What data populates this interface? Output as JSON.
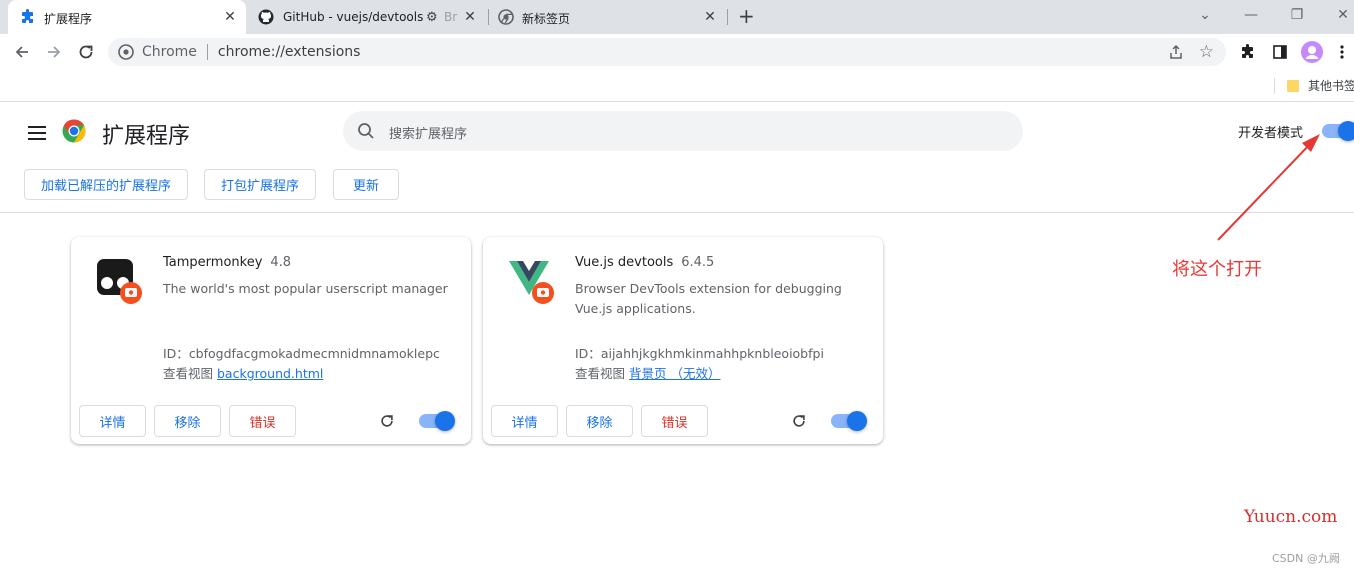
{
  "browser": {
    "tabs": [
      {
        "title": "扩展程序",
        "icon": "puzzle-icon",
        "active": true
      },
      {
        "title": "GitHub - vuejs/devtools:",
        "suffix": "Br",
        "icon": "github-icon",
        "active": false
      },
      {
        "title": "新标签页",
        "icon": "chrome-icon",
        "active": false
      }
    ],
    "new_tab_label": "+",
    "omnibox": {
      "site_label": "Chrome",
      "url": "chrome://extensions"
    },
    "bookmarks": {
      "other_label": "其他书签"
    },
    "accent": "#1a73e8"
  },
  "page": {
    "title": "扩展程序",
    "search_placeholder": "搜索扩展程序",
    "dev_mode_label": "开发者模式",
    "dev_mode_on": true,
    "actions": {
      "load_unpacked": "加载已解压的扩展程序",
      "pack": "打包扩展程序",
      "update": "更新"
    }
  },
  "extensions": [
    {
      "name": "Tampermonkey",
      "version": "4.8",
      "description": "The world's most popular userscript manager",
      "id_label": "ID：",
      "id": "cbfogdfacgmokadmecmnidmnamoklepc",
      "views_label": "查看视图",
      "view_link": "background.html",
      "details": "详情",
      "remove": "移除",
      "errors": "错误",
      "enabled": true
    },
    {
      "name": "Vue.js devtools",
      "version": "6.4.5",
      "description": "Browser DevTools extension for debugging Vue.js applications.",
      "id_label": "ID：",
      "id": "aijahhjkgkhmkinmahhpknbleoiobfpi",
      "views_label": "查看视图",
      "view_link": "背景页 （无效）",
      "details": "详情",
      "remove": "移除",
      "errors": "错误",
      "enabled": true
    }
  ],
  "annotation": {
    "text": "将这个打开",
    "color": "#e53935"
  },
  "watermarks": {
    "site": "Yuucn.com",
    "csdn": "CSDN @九阙"
  }
}
